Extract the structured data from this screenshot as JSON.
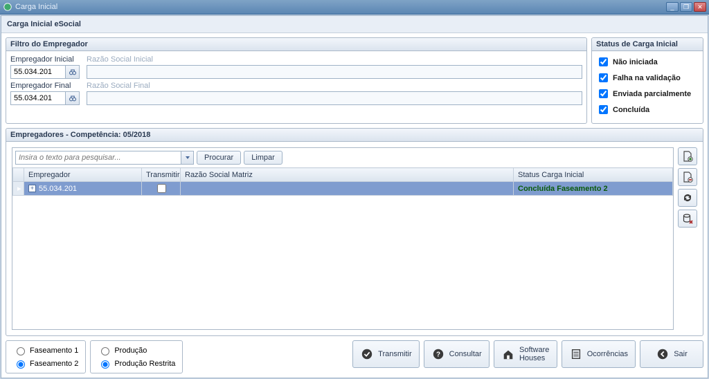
{
  "window": {
    "title": "Carga Inicial"
  },
  "page_title": "Carga Inicial eSocial",
  "filter": {
    "group_title": "Filtro do Empregador",
    "empregador_inicial_label": "Empregador Inicial",
    "razao_inicial_label": "Razão Social Inicial",
    "empregador_inicial_value": "55.034.201",
    "razao_inicial_value": "",
    "empregador_final_label": "Empregador Final",
    "razao_final_label": "Razão Social Final",
    "empregador_final_value": "55.034.201",
    "razao_final_value": ""
  },
  "status": {
    "group_title": "Status de Carga Inicial",
    "items": [
      "Não iniciada",
      "Falha na validação",
      "Enviada parcialmente",
      "Concluída"
    ]
  },
  "employers": {
    "group_title": "Empregadores - Competência: 05/2018",
    "search_placeholder": "Insira o texto para pesquisar...",
    "procurar_label": "Procurar",
    "limpar_label": "Limpar",
    "cols": {
      "empregador": "Empregador",
      "transmitir": "Transmitir",
      "razao_matriz": "Razão Social Matriz",
      "status": "Status Carga Inicial"
    },
    "rows": [
      {
        "empregador": "55.034.201",
        "transmitir": false,
        "razao_matriz": "",
        "status": "Concluída Faseamento 2"
      }
    ]
  },
  "faseamento": {
    "opt1": "Faseamento 1",
    "opt2": "Faseamento 2",
    "selected": "Faseamento 2"
  },
  "producao": {
    "opt1": "Produção",
    "opt2": "Produção Restrita",
    "selected": "Produção Restrita"
  },
  "buttons": {
    "transmitir": "Transmitir",
    "consultar": "Consultar",
    "software_houses": "Software\nHouses",
    "ocorrencias": "Ocorrências",
    "sair": "Sair"
  },
  "icons": {
    "doc_add": "doc-add",
    "doc_remove": "doc-remove",
    "refresh": "refresh",
    "db_delete": "db-delete",
    "binoculars": "binoculars"
  }
}
